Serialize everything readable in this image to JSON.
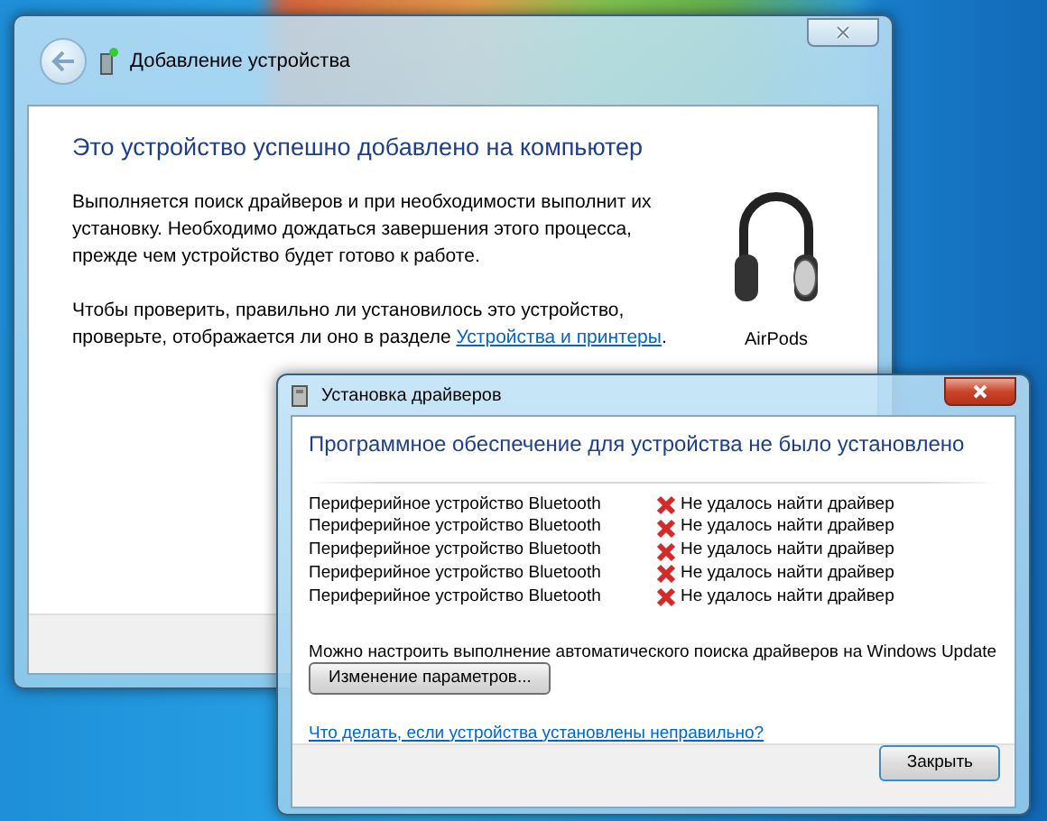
{
  "main_window": {
    "title": "Добавление устройства",
    "heading": "Это устройство успешно добавлено на компьютер",
    "paragraph_1": "Выполняется поиск драйверов и при необходимости выполнит их установку. Необходимо дождаться завершения этого процесса, прежде чем устройство будет готово к работе.",
    "paragraph_2": {
      "text": "Чтобы проверить, правильно ли установилось это устройство, проверьте, отображается ли оно в разделе",
      "link": "Устройства и принтеры",
      "after": "."
    },
    "device_label": "AirPods"
  },
  "driver_dialog": {
    "title": "Установка драйверов",
    "heading": "Программное обеспечение для устройства не было установлено",
    "devices": [
      {
        "name": "Периферийное устройство Bluetooth",
        "status": "Не удалось найти драйвер"
      },
      {
        "name": "Периферийное устройство Bluetooth",
        "status": "Не удалось найти драйвер"
      },
      {
        "name": "Периферийное устройство Bluetooth",
        "status": "Не удалось найти драйвер"
      },
      {
        "name": "Периферийное устройство Bluetooth",
        "status": "Не удалось найти драйвер"
      },
      {
        "name": "Периферийное устройство Bluetooth",
        "status": "Не удалось найти драйвер"
      }
    ],
    "note": "Можно настроить выполнение автоматического поиска драйверов на Windows Update",
    "settings_button": "Изменение параметров...",
    "help_link": "Что делать, если устройства установлены неправильно?",
    "close_button": "Закрыть"
  }
}
